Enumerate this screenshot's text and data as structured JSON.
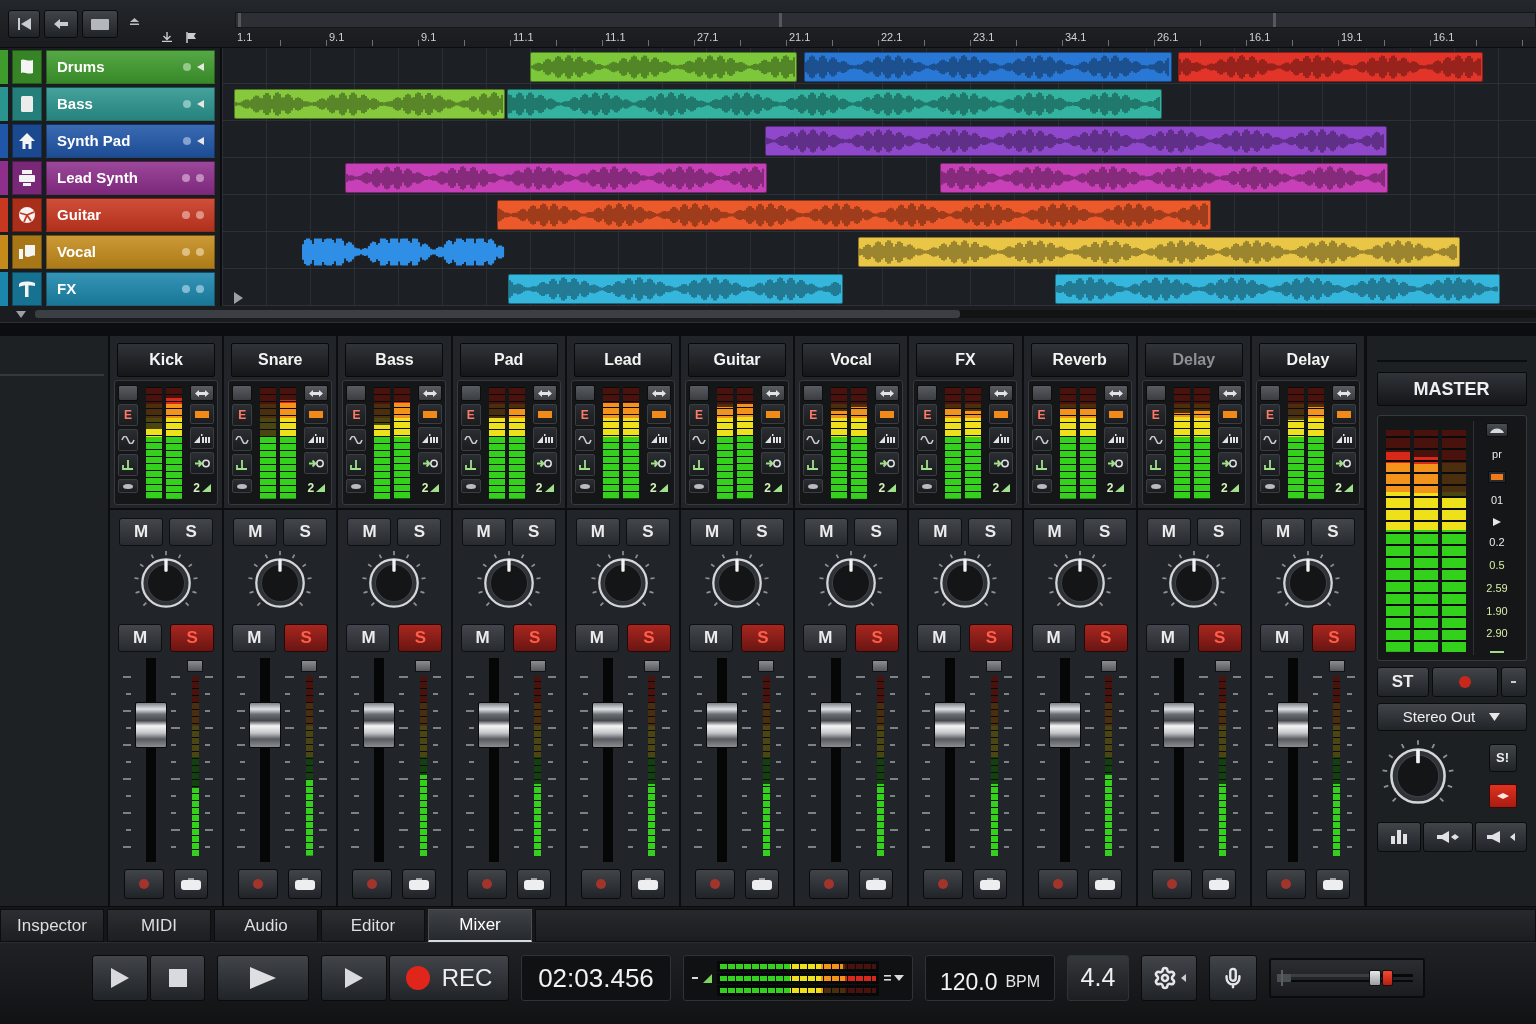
{
  "ruler": {
    "labels": [
      "1.1",
      "9.1",
      "9.1",
      "11.1",
      "11.1",
      "27.1",
      "21.1",
      "22.1",
      "23.1",
      "34.1",
      "26.1",
      "16.1",
      "19.1",
      "16.1"
    ]
  },
  "tracks": [
    {
      "name": "Drums",
      "color": "#3f9b2c",
      "monitor": true,
      "clips": [
        {
          "kind": "clip",
          "color": "#7cc83a"
        },
        {
          "kind": "clip",
          "color": "#2a78d6"
        },
        {
          "kind": "clip",
          "color": "#e3342a"
        }
      ]
    },
    {
      "name": "Bass",
      "color": "#2a948e",
      "monitor": true,
      "clips": [
        {
          "kind": "clip",
          "color": "#86c93c"
        },
        {
          "kind": "clip",
          "color": "#33b3a0"
        }
      ]
    },
    {
      "name": "Synth Pad",
      "color": "#1f56a8",
      "monitor": true,
      "clips": [
        {
          "kind": "clip",
          "color": "#8f48cc"
        }
      ]
    },
    {
      "name": "Lead Synth",
      "color": "#8e2f8c",
      "monitor": false,
      "clips": [
        {
          "kind": "clip",
          "color": "#c840b8"
        },
        {
          "kind": "clip",
          "color": "#c840b8"
        }
      ]
    },
    {
      "name": "Guitar",
      "color": "#c8371f",
      "monitor": false,
      "clips": [
        {
          "kind": "clip",
          "color": "#ec5a2c"
        }
      ]
    },
    {
      "name": "Vocal",
      "color": "#c48b1a",
      "monitor": false,
      "clips": [
        {
          "kind": "bare",
          "color": "#2f8fe6"
        },
        {
          "kind": "clip",
          "color": "#e9c646"
        }
      ]
    },
    {
      "name": "FX",
      "color": "#1b86ac",
      "monitor": false,
      "clips": [
        {
          "kind": "clip",
          "color": "#35b6dc"
        },
        {
          "kind": "clip",
          "color": "#35b6dc"
        }
      ]
    }
  ],
  "mixer": {
    "channels": [
      {
        "name": "Kick",
        "dimmed": false,
        "insert_label": "E",
        "send_label": "2",
        "meters": [
          {
            "level": 0.62
          },
          {
            "level": 0.9
          }
        ],
        "upper_buttons": [
          {
            "label": "M",
            "on": false
          },
          {
            "label": "S",
            "on": false
          }
        ],
        "lower_buttons": [
          {
            "label": "M",
            "on": false
          },
          {
            "label": "S",
            "on": true
          }
        ],
        "fader": {
          "level": 0.72
        },
        "fader_meter": {
          "level": 0.38
        }
      },
      {
        "name": "Snare",
        "dimmed": false,
        "insert_label": "E",
        "send_label": "2",
        "meters": [
          {
            "level": 0.55
          },
          {
            "level": 0.88
          }
        ],
        "upper_buttons": [
          {
            "label": "M",
            "on": false
          },
          {
            "label": "S",
            "on": false
          }
        ],
        "lower_buttons": [
          {
            "label": "M",
            "on": false
          },
          {
            "label": "S",
            "on": true
          }
        ],
        "fader": {
          "level": 0.72
        },
        "fader_meter": {
          "level": 0.42
        }
      },
      {
        "name": "Bass",
        "dimmed": false,
        "insert_label": "E",
        "send_label": "2",
        "meters": [
          {
            "level": 0.66
          },
          {
            "level": 0.86
          }
        ],
        "upper_buttons": [
          {
            "label": "M",
            "on": false
          },
          {
            "label": "S",
            "on": false
          }
        ],
        "lower_buttons": [
          {
            "label": "M",
            "on": false
          },
          {
            "label": "S",
            "on": true
          }
        ],
        "fader": {
          "level": 0.72
        },
        "fader_meter": {
          "level": 0.45
        }
      },
      {
        "name": "Pad",
        "dimmed": false,
        "insert_label": "E",
        "send_label": "2",
        "meters": [
          {
            "level": 0.72
          },
          {
            "level": 0.8
          }
        ],
        "upper_buttons": [
          {
            "label": "M",
            "on": false
          },
          {
            "label": "S",
            "on": false
          }
        ],
        "lower_buttons": [
          {
            "label": "M",
            "on": false
          },
          {
            "label": "S",
            "on": true
          }
        ],
        "fader": {
          "level": 0.72
        },
        "fader_meter": {
          "level": 0.4
        }
      },
      {
        "name": "Lead",
        "dimmed": false,
        "insert_label": "E",
        "send_label": "2",
        "meters": [
          {
            "level": 0.85
          },
          {
            "level": 0.85
          }
        ],
        "upper_buttons": [
          {
            "label": "M",
            "on": false
          },
          {
            "label": "S",
            "on": false
          }
        ],
        "lower_buttons": [
          {
            "label": "M",
            "on": false
          },
          {
            "label": "S",
            "on": true
          }
        ],
        "fader": {
          "level": 0.72
        },
        "fader_meter": {
          "level": 0.4
        }
      },
      {
        "name": "Guitar",
        "dimmed": false,
        "insert_label": "E",
        "send_label": "2",
        "meters": [
          {
            "level": 0.82
          },
          {
            "level": 0.84
          }
        ],
        "upper_buttons": [
          {
            "label": "M",
            "on": false
          },
          {
            "label": "S",
            "on": false
          }
        ],
        "lower_buttons": [
          {
            "label": "M",
            "on": false
          },
          {
            "label": "S",
            "on": true
          }
        ],
        "fader": {
          "level": 0.72
        },
        "fader_meter": {
          "level": 0.4
        }
      },
      {
        "name": "Vocal",
        "dimmed": false,
        "insert_label": "E",
        "send_label": "2",
        "meters": [
          {
            "level": 0.78
          },
          {
            "level": 0.82
          }
        ],
        "upper_buttons": [
          {
            "label": "M",
            "on": false
          },
          {
            "label": "S",
            "on": false
          }
        ],
        "lower_buttons": [
          {
            "label": "M",
            "on": false
          },
          {
            "label": "S",
            "on": true
          }
        ],
        "fader": {
          "level": 0.72
        },
        "fader_meter": {
          "level": 0.4
        }
      },
      {
        "name": "FX",
        "dimmed": false,
        "insert_label": "E",
        "send_label": "2",
        "meters": [
          {
            "level": 0.8
          },
          {
            "level": 0.78
          }
        ],
        "upper_buttons": [
          {
            "label": "M",
            "on": false
          },
          {
            "label": "S",
            "on": false
          }
        ],
        "lower_buttons": [
          {
            "label": "M",
            "on": false
          },
          {
            "label": "S",
            "on": true
          }
        ],
        "fader": {
          "level": 0.72
        },
        "fader_meter": {
          "level": 0.4
        }
      },
      {
        "name": "Reverb",
        "dimmed": false,
        "insert_label": "E",
        "send_label": "2",
        "meters": [
          {
            "level": 0.8
          },
          {
            "level": 0.8
          }
        ],
        "upper_buttons": [
          {
            "label": "M",
            "on": false
          },
          {
            "label": "S",
            "on": false
          }
        ],
        "lower_buttons": [
          {
            "label": "M",
            "on": false
          },
          {
            "label": "S",
            "on": true
          }
        ],
        "fader": {
          "level": 0.72
        },
        "fader_meter": {
          "level": 0.45
        }
      },
      {
        "name": "Delay",
        "dimmed": true,
        "insert_label": "E",
        "send_label": "2",
        "meters": [
          {
            "level": 0.76
          },
          {
            "level": 0.78
          }
        ],
        "upper_buttons": [
          {
            "label": "M",
            "on": false
          },
          {
            "label": "S",
            "on": false
          }
        ],
        "lower_buttons": [
          {
            "label": "M",
            "on": false
          },
          {
            "label": "S",
            "on": true
          }
        ],
        "fader": {
          "level": 0.72
        },
        "fader_meter": {
          "level": 0.4
        }
      },
      {
        "name": "Delay",
        "dimmed": false,
        "insert_label": "E",
        "send_label": "2",
        "meters": [
          {
            "level": 0.7
          },
          {
            "level": 0.82
          }
        ],
        "upper_buttons": [
          {
            "label": "M",
            "on": false
          },
          {
            "label": "S",
            "on": false
          }
        ],
        "lower_buttons": [
          {
            "label": "M",
            "on": false
          },
          {
            "label": "S",
            "on": true
          }
        ],
        "fader": {
          "level": 0.72
        },
        "fader_meter": {
          "level": 0.4
        }
      }
    ]
  },
  "master": {
    "title": "MASTER",
    "meters": [
      {
        "level": 0.9
      },
      {
        "level": 0.88
      },
      {
        "level": 0.7
      }
    ],
    "scale": [
      "pr",
      "01",
      "0.2",
      "0.5",
      "2.59",
      "1.90",
      "2.90"
    ],
    "stereo_label": "ST",
    "output": "Stereo Out",
    "solo_label": "S!"
  },
  "tabs": [
    {
      "label": "Inspector",
      "selected": false
    },
    {
      "label": "MIDI",
      "selected": false
    },
    {
      "label": "Audio",
      "selected": false
    },
    {
      "label": "Editor",
      "selected": false
    },
    {
      "label": "Mixer",
      "selected": true
    }
  ],
  "transport": {
    "rec_label": "REC",
    "time": "02:03.456",
    "meter": [
      {
        "level": 0.79
      },
      {
        "level": 1
      },
      {
        "level": 0.66
      }
    ],
    "tempo": "120.0",
    "tempo_unit": "BPM",
    "signature": "4.4",
    "volume": {
      "level": 0.64
    }
  }
}
